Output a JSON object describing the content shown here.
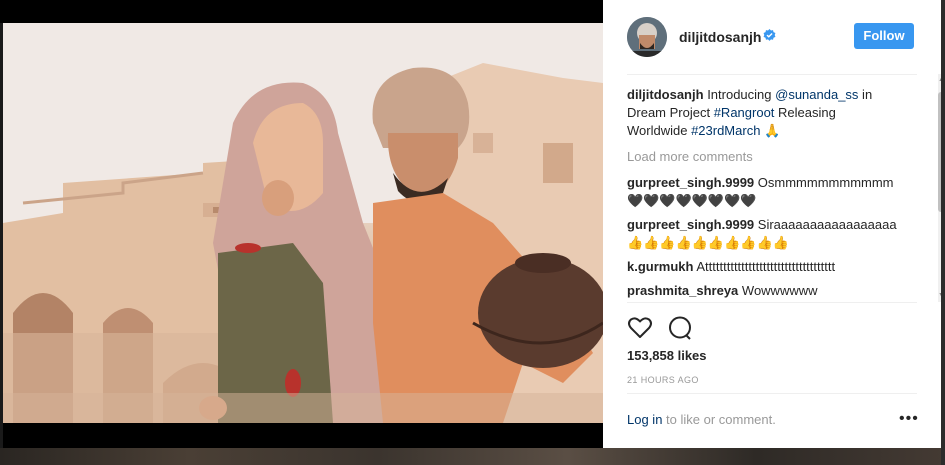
{
  "post": {
    "username": "diljitdosanjh",
    "follow_label": "Follow",
    "caption": {
      "user": "diljitdosanjh",
      "text_1": "Introducing ",
      "mention": "@sunanda_ss",
      "text_2": " in Dream Project ",
      "hashtag_1": "#Rangroot",
      "text_3": " Releasing Worldwide ",
      "hashtag_2": "#23rdMarch",
      "emoji": "🙏"
    },
    "load_more_label": "Load more comments",
    "comments": [
      {
        "user": "gurpreet_singh.9999",
        "text": "Osmmmmmmmmmmm 🖤🖤🖤🖤🖤🖤🖤🖤"
      },
      {
        "user": "gurpreet_singh.9999",
        "text": "Siraaaaaaaaaaaaaaaaa 👍👍👍👍👍👍👍👍👍👍"
      },
      {
        "user": "k.gurmukh",
        "text": "Atttttttttttttttttttttttttttttttttttt"
      },
      {
        "user": "prashmita_shreya",
        "text": "Wowwwwww"
      }
    ],
    "likes": "153,858 likes",
    "time": "21 HOURS AGO",
    "login_link": "Log in",
    "login_text": " to like or comment.",
    "more_icon": "more-horizontal-icon"
  },
  "colors": {
    "follow_bg": "#3897f0",
    "link": "#003569",
    "muted": "#999999",
    "verified": "#3897f0"
  }
}
